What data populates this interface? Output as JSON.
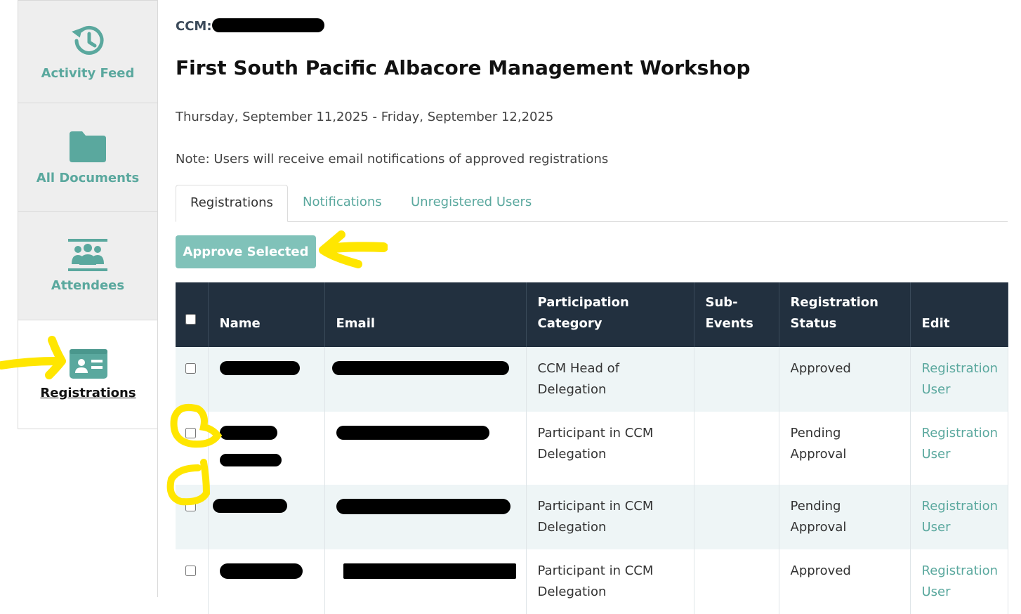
{
  "sidebar": {
    "items": [
      {
        "label": "Activity Feed",
        "icon": "history-icon"
      },
      {
        "label": "All Documents",
        "icon": "folder-icon"
      },
      {
        "label": "Attendees",
        "icon": "attendees-icon"
      },
      {
        "label": "Registrations",
        "icon": "id-card-icon",
        "active": true
      }
    ]
  },
  "header": {
    "ccm_label": "CCM:",
    "title": "First South Pacific Albacore Management Workshop",
    "dates": "Thursday, September 11,2025 - Friday, September 12,2025",
    "note": "Note: Users will receive email notifications of approved registrations"
  },
  "tabs": [
    {
      "label": "Registrations",
      "active": true
    },
    {
      "label": "Notifications"
    },
    {
      "label": "Unregistered Users"
    }
  ],
  "toolbar": {
    "approve_label": "Approve Selected"
  },
  "table": {
    "columns": [
      "Name",
      "Email",
      "Participation Category",
      "Sub-Events",
      "Registration Status",
      "Edit"
    ],
    "rows": [
      {
        "category": "CCM Head of Delegation",
        "sub_events": "",
        "status": "Approved",
        "edit_links": [
          "Registration",
          "User"
        ]
      },
      {
        "category": "Participant in CCM Delegation",
        "sub_events": "",
        "status": "Pending Approval",
        "edit_links": [
          "Registration",
          "User"
        ]
      },
      {
        "category": "Participant in CCM Delegation",
        "sub_events": "",
        "status": "Pending Approval",
        "edit_links": [
          "Registration",
          "User"
        ]
      },
      {
        "category": "Participant in CCM Delegation",
        "sub_events": "",
        "status": "Approved",
        "edit_links": [
          "Registration",
          "User"
        ]
      }
    ]
  },
  "colors": {
    "accent": "#5aa89e",
    "header_bg": "#22303f",
    "button_bg": "#80c2b9",
    "annotation": "#ffe600"
  }
}
